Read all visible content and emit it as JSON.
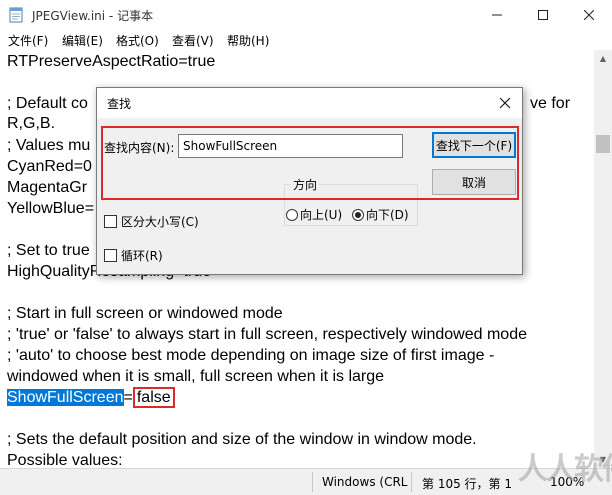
{
  "window": {
    "title": "JPEGView.ini - 记事本",
    "minimize_glyph": "—",
    "maximize_glyph": "☐",
    "close_glyph": "✕",
    "icon": "notepad-icon"
  },
  "menu": [
    {
      "label": "文件(F)"
    },
    {
      "label": "编辑(E)"
    },
    {
      "label": "格式(O)"
    },
    {
      "label": "查看(V)"
    },
    {
      "label": "帮助(H)"
    }
  ],
  "editor": {
    "lines": {
      "l1": "RTPreserveAspectRatio=true",
      "l3a": "; Default co",
      "l3b": "ve for",
      "l4": "R,G,B.",
      "l5": "; Values mu",
      "l6": "CyanRed=0",
      "l7": "MagentaGr",
      "l8": "YellowBlue=",
      "l10": "; Set to true",
      "l11": "HighQualityResampling=true",
      "l13": "; Start in full screen or windowed mode",
      "l14": "; 'true' or 'false' to always start in full screen, respectively windowed mode",
      "l15": "; 'auto' to choose best mode depending on image size of first image -",
      "l16": "windowed when it is small, full screen when it is large",
      "l17_selected": "ShowFullScreen",
      "l17_eq": "=",
      "l17_value": "false",
      "l19": "; Sets the default position and size of the window in window mode.",
      "l20": "Possible values:"
    }
  },
  "statusbar": {
    "encoding": "Windows (CRL",
    "position": "第 105 行，第 1",
    "zoom": "100%"
  },
  "watermark": "人人软件",
  "find_dialog": {
    "title": "查找",
    "close_glyph": "✕",
    "find_label": "查找内容(N):",
    "find_value": "ShowFullScreen",
    "find_next_label": "查找下一个(F)",
    "cancel_label": "取消",
    "direction_label": "方向",
    "up_label": "向上(U)",
    "down_label": "向下(D)",
    "direction_selected": "down",
    "match_case_label": "区分大小写(C)",
    "match_case_checked": false,
    "wrap_label": "循环(R)",
    "wrap_checked": false
  },
  "colors": {
    "selection": "#0078d7",
    "annotation_red": "#d92b2b"
  }
}
